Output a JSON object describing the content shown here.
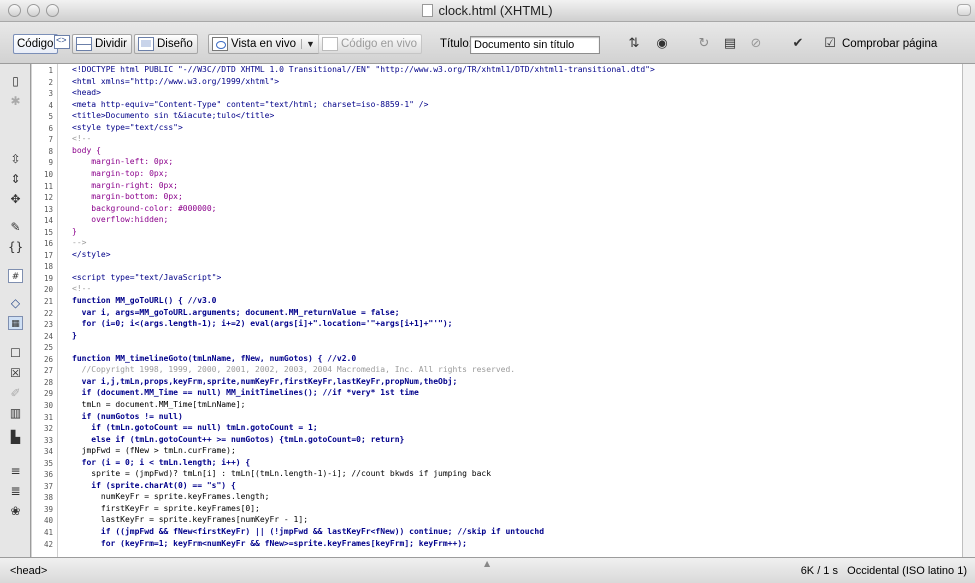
{
  "window": {
    "title": "clock.html (XHTML)"
  },
  "toolbar": {
    "code_label": "Código",
    "split_label": "Dividir",
    "design_label": "Diseño",
    "live_view_label": "Vista en vivo",
    "live_code_label": "Código en vivo",
    "title_label": "Título:",
    "title_value": "Documento sin título",
    "check_page_label": "Comprobar página"
  },
  "editor": {
    "line_numbers": [
      "1",
      "2",
      "3",
      "4",
      "5",
      "6",
      "7",
      "8",
      "9",
      "10",
      "11",
      "12",
      "13",
      "14",
      "15",
      "16",
      "17",
      "18",
      "19",
      "20",
      "21",
      "22",
      "23",
      "24",
      "25",
      "26",
      "27",
      "28",
      "29",
      "30",
      "31",
      "32",
      "33",
      "34",
      "35",
      "36",
      "37",
      "38",
      "39",
      "40",
      "41",
      "42"
    ],
    "lines": [
      "<!DOCTYPE html PUBLIC \"-//W3C//DTD XHTML 1.0 Transitional//EN\" \"http://www.w3.org/TR/xhtml1/DTD/xhtml1-transitional.dtd\">",
      "<html xmlns=\"http://www.w3.org/1999/xhtml\">",
      "<head>",
      "<meta http-equiv=\"Content-Type\" content=\"text/html; charset=iso-8859-1\" />",
      "<title>Documento sin t&iacute;tulo</title>",
      "<style type=\"text/css\">",
      "<!--",
      "body {",
      "    margin-left: 0px;",
      "    margin-top: 0px;",
      "    margin-right: 0px;",
      "    margin-bottom: 0px;",
      "    background-color: #000000;",
      "    overflow:hidden;",
      "}",
      "-->",
      "</style>",
      "",
      "<script type=\"text/JavaScript\">",
      "<!--",
      "function MM_goToURL() { //v3.0",
      "  var i, args=MM_goToURL.arguments; document.MM_returnValue = false;",
      "  for (i=0; i<(args.length-1); i+=2) eval(args[i]+\".location='\"+args[i+1]+\"'\");",
      "}",
      "",
      "function MM_timelineGoto(tmLnName, fNew, numGotos) { //v2.0",
      "  //Copyright 1998, 1999, 2000, 2001, 2002, 2003, 2004 Macromedia, Inc. All rights reserved.",
      "  var i,j,tmLn,props,keyFrm,sprite,numKeyFr,firstKeyFr,lastKeyFr,propNum,theObj;",
      "  if (document.MM_Time == null) MM_initTimelines(); //if *very* 1st time",
      "  tmLn = document.MM_Time[tmLnName];",
      "  if (numGotos != null)",
      "    if (tmLn.gotoCount == null) tmLn.gotoCount = 1;",
      "    else if (tmLn.gotoCount++ >= numGotos) {tmLn.gotoCount=0; return}",
      "  jmpFwd = (fNew > tmLn.curFrame);",
      "  for (i = 0; i < tmLn.length; i++) {",
      "    sprite = (jmpFwd)? tmLn[i] : tmLn[(tmLn.length-1)-i]; //count bkwds if jumping back",
      "    if (sprite.charAt(0) == \"s\") {",
      "      numKeyFr = sprite.keyFrames.length;",
      "      firstKeyFr = sprite.keyFrames[0];",
      "      lastKeyFr = sprite.keyFrames[numKeyFr - 1];",
      "      if ((jmpFwd && fNew<firstKeyFr) || (!jmpFwd && lastKeyFr<fNew)) continue; //skip if untouchd",
      "      for (keyFrm=1; keyFrm<numKeyFr && fNew>=sprite.keyFrames[keyFrm]; keyFrm++);"
    ]
  },
  "statusbar": {
    "tag_selector": "<head>",
    "size_time": "6K / 1 s",
    "encoding": "Occidental (ISO latino 1)"
  }
}
